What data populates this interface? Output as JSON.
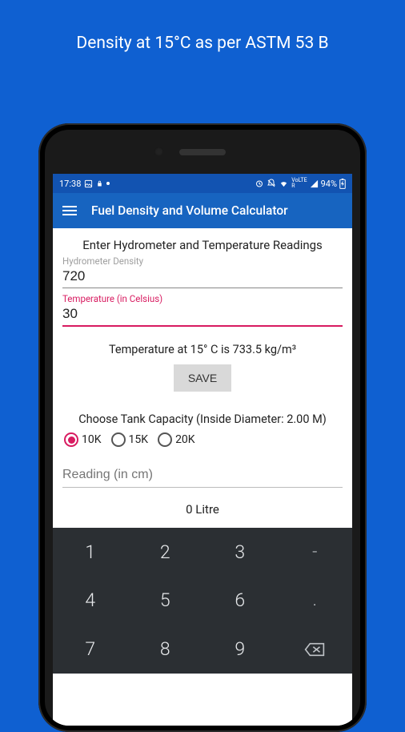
{
  "page_title": "Density at 15°C as per ASTM 53 B",
  "status": {
    "time": "17:38",
    "battery": "94%"
  },
  "appbar": {
    "title": "Fuel Density and Volume Calculator"
  },
  "form": {
    "heading": "Enter Hydrometer and Temperature Readings",
    "density_label": "Hydrometer Density",
    "density_value": "720",
    "temp_label": "Temperature (in Celsius)",
    "temp_value": "30",
    "result": "Temperature at 15° C is 733.5 kg/m³",
    "save_label": "SAVE"
  },
  "tank": {
    "heading": "Choose Tank Capacity (Inside Diameter: 2.00 M)",
    "options": [
      "10K",
      "15K",
      "20K"
    ],
    "selected_index": 0,
    "reading_placeholder": "Reading (in cm)",
    "litre_result": "0 Litre"
  },
  "keyboard_keys": [
    "1",
    "2",
    "3",
    "-",
    "4",
    "5",
    "6",
    ".",
    "7",
    "8",
    "9",
    "⌫"
  ]
}
